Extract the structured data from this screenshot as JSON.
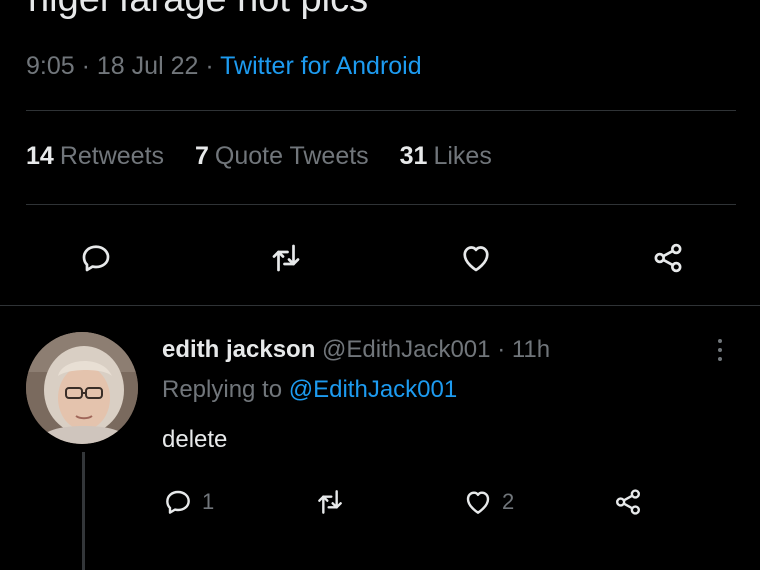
{
  "tweet": {
    "text": "nigel farage hot pics",
    "time": "9:05",
    "date": "18 Jul 22",
    "separator": "·",
    "source": "Twitter for Android"
  },
  "stats": {
    "retweets_count": "14",
    "retweets_label": "Retweets",
    "quotes_count": "7",
    "quotes_label": "Quote Tweets",
    "likes_count": "31",
    "likes_label": "Likes"
  },
  "actions": {
    "icons": [
      "reply-icon",
      "retweet-icon",
      "like-icon",
      "share-icon"
    ]
  },
  "reply": {
    "name": "edith jackson",
    "handle": "@EdithJack001",
    "separator": "·",
    "age": "11h",
    "replying_prefix": "Replying to",
    "replying_handle": "@EdithJack001",
    "text": "delete",
    "reply_count": "1",
    "like_count": "2"
  },
  "colors": {
    "background": "#000000",
    "text": "#e7e9ea",
    "muted": "#71767b",
    "link": "#1d9bf0",
    "divider": "#2f3336"
  }
}
